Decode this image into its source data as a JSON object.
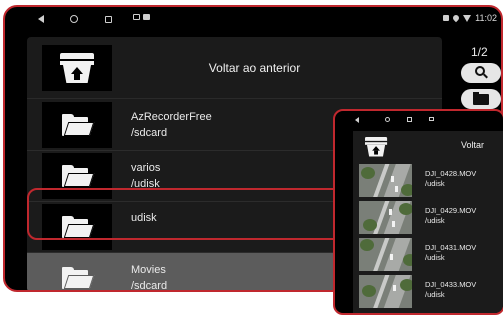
{
  "main_device": {
    "status_bar": {
      "time": "11:02"
    },
    "back_row": {
      "label": "Voltar ao anterior"
    },
    "folders": [
      {
        "name": "AzRecorderFree",
        "path": "/sdcard"
      },
      {
        "name": "varios",
        "path": "/udisk"
      },
      {
        "name": "udisk",
        "path": ""
      },
      {
        "name": "Movies",
        "path": "/sdcard"
      }
    ],
    "sidebar": {
      "page": "1/2"
    }
  },
  "overlay_device": {
    "back_row": {
      "label": "Voltar"
    },
    "videos": [
      {
        "name": "DJI_0428.MOV",
        "path": "/udisk"
      },
      {
        "name": "DJI_0429.MOV",
        "path": "/udisk"
      },
      {
        "name": "DJI_0431.MOV",
        "path": "/udisk"
      },
      {
        "name": "DJI_0433.MOV",
        "path": "/udisk"
      }
    ]
  },
  "colors": {
    "highlight": "#c0282e",
    "selected_row": "#5c5c5c",
    "panel": "#1b1b1b"
  },
  "icons": [
    "back-icon",
    "home-icon",
    "recents-icon",
    "folder-icon",
    "folder-up-icon",
    "search-icon",
    "wifi-icon",
    "location-icon",
    "bluetooth-icon"
  ]
}
